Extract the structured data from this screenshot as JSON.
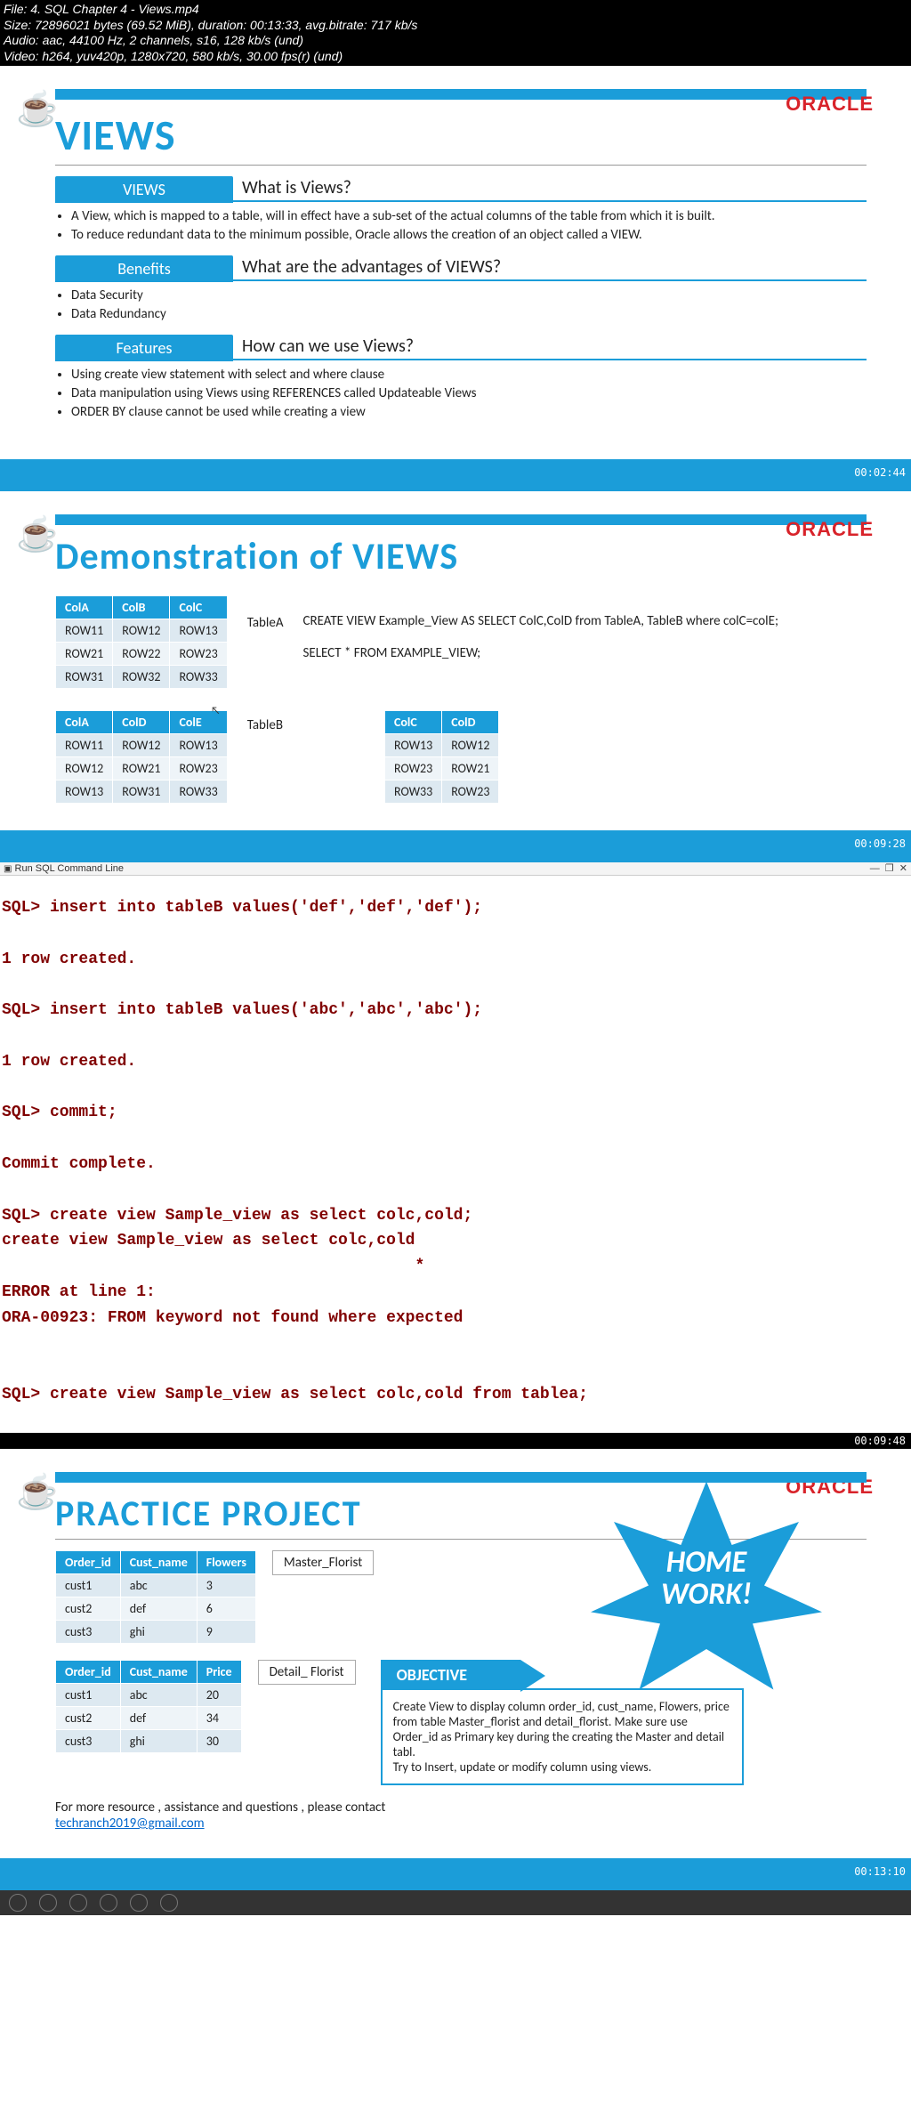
{
  "file_header": {
    "file_line": "File: 4. SQL  Chapter 4 - Views.mp4",
    "size_line": "Size: 72896021 bytes (69.52 MiB), duration: 00:13:33, avg.bitrate: 717 kb/s",
    "audio_line": "Audio: aac, 44100 Hz, 2 channels, s16, 128 kb/s (und)",
    "video_line": "Video: h264, yuv420p, 1280x720, 580 kb/s, 30.00 fps(r) (und)"
  },
  "brand": {
    "oracle": "ORACLE",
    "java_icon": "☕"
  },
  "slide1": {
    "title": "VIEWS",
    "sec1": {
      "tab": "VIEWS",
      "q": "What is Views?",
      "bullets": [
        "A View, which is mapped to a table, will in effect have a sub-set of the actual columns of the table from which it is built.",
        "To reduce redundant data to the minimum possible, Oracle allows the creation of an object called a VIEW."
      ]
    },
    "sec2": {
      "tab": "Benefits",
      "q": "What are the advantages of VIEWS?",
      "bullets": [
        "Data Security",
        "Data Redundancy"
      ]
    },
    "sec3": {
      "tab": "Features",
      "q": "How can we use Views?",
      "bullets": [
        "Using create view statement with select and where clause",
        "Data manipulation using Views using REFERENCES called Updateable Views",
        "ORDER BY clause cannot be used while creating a view"
      ]
    },
    "time": "00:02:44"
  },
  "slide2": {
    "title": "Demonstration of VIEWS",
    "tableA": {
      "name": "TableA",
      "headers": [
        "ColA",
        "ColB",
        "ColC"
      ],
      "rows": [
        [
          "ROW11",
          "ROW12",
          "ROW13"
        ],
        [
          "ROW21",
          "ROW22",
          "ROW23"
        ],
        [
          "ROW31",
          "ROW32",
          "ROW33"
        ]
      ]
    },
    "tableB": {
      "name": "TableB",
      "headers": [
        "ColA",
        "ColD",
        "ColE"
      ],
      "rows": [
        [
          "ROW11",
          "ROW12",
          "ROW13"
        ],
        [
          "ROW12",
          "ROW21",
          "ROW23"
        ],
        [
          "ROW13",
          "ROW31",
          "ROW33"
        ]
      ]
    },
    "sql1": "CREATE VIEW Example_View AS SELECT ColC,ColD from TableA, TableB where colC=colE;",
    "sql2": "SELECT * FROM EXAMPLE_VIEW;",
    "tableR": {
      "headers": [
        "ColC",
        "ColD"
      ],
      "rows": [
        [
          "ROW13",
          "ROW12"
        ],
        [
          "ROW23",
          "ROW21"
        ],
        [
          "ROW33",
          "ROW23"
        ]
      ]
    },
    "time": "00:09:28"
  },
  "terminal": {
    "title": "Run SQL Command Line",
    "lines": [
      "SQL> insert into tableB values('def','def','def');",
      "",
      "1 row created.",
      "",
      "SQL> insert into tableB values('abc','abc','abc');",
      "",
      "1 row created.",
      "",
      "SQL> commit;",
      "",
      "Commit complete.",
      "",
      "SQL> create view Sample_view as select colc,cold;",
      "create view Sample_view as select colc,cold",
      "                                           *",
      "ERROR at line 1:",
      "ORA-00923: FROM keyword not found where expected",
      "",
      "",
      "SQL> create view Sample_view as select colc,cold from tablea;"
    ],
    "time": "00:09:48"
  },
  "slide3": {
    "title": "PRACTICE PROJECT",
    "star_text1": "HOME",
    "star_text2": "WORK!",
    "master": {
      "label": "Master_Florist",
      "headers": [
        "Order_id",
        "Cust_name",
        "Flowers"
      ],
      "rows": [
        [
          "cust1",
          "abc",
          "3"
        ],
        [
          "cust2",
          "def",
          "6"
        ],
        [
          "cust3",
          "ghi",
          "9"
        ]
      ]
    },
    "detail": {
      "label": "Detail_ Florist",
      "headers": [
        "Order_id",
        "Cust_name",
        "Price"
      ],
      "rows": [
        [
          "cust1",
          "abc",
          "20"
        ],
        [
          "cust2",
          "def",
          "34"
        ],
        [
          "cust3",
          "ghi",
          "30"
        ]
      ]
    },
    "obj_label": "OBJECTIVE",
    "obj_text": "Create View to display column order_id, cust_name, Flowers, price from table Master_florist and detail_florist. Make sure use Order_id as Primary key during the creating the Master and detail tabl.\nTry to Insert, update or modify column using views.",
    "footer_text": "For more resource , assistance and questions , please contact",
    "email": "techranch2019@gmail.com",
    "time": "00:13:10"
  }
}
